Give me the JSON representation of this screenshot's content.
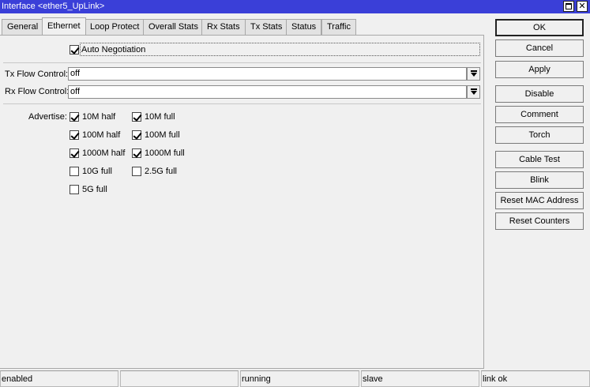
{
  "window": {
    "title": "Interface <ether5_UpLink>",
    "title_color": "#3a3fd8"
  },
  "tabs": [
    {
      "label": "General",
      "active": false
    },
    {
      "label": "Ethernet",
      "active": true
    },
    {
      "label": "Loop Protect",
      "active": false
    },
    {
      "label": "Overall Stats",
      "active": false
    },
    {
      "label": "Rx Stats",
      "active": false
    },
    {
      "label": "Tx Stats",
      "active": false
    },
    {
      "label": "Status",
      "active": false
    },
    {
      "label": "Traffic",
      "active": false
    }
  ],
  "ethernet": {
    "auto_negotiation": {
      "label": "Auto Negotiation",
      "checked": true
    },
    "tx_flow_control": {
      "label": "Tx Flow Control:",
      "value": "off"
    },
    "rx_flow_control": {
      "label": "Rx Flow Control:",
      "value": "off"
    },
    "advertise": {
      "label": "Advertise:",
      "options": [
        {
          "label": "10M half",
          "checked": true
        },
        {
          "label": "10M full",
          "checked": true
        },
        {
          "label": "100M half",
          "checked": true
        },
        {
          "label": "100M full",
          "checked": true
        },
        {
          "label": "1000M half",
          "checked": true
        },
        {
          "label": "1000M full",
          "checked": true
        },
        {
          "label": "10G full",
          "checked": false
        },
        {
          "label": "2.5G full",
          "checked": false
        },
        {
          "label": "5G full",
          "checked": false
        }
      ]
    }
  },
  "buttons": {
    "ok": "OK",
    "cancel": "Cancel",
    "apply": "Apply",
    "disable": "Disable",
    "comment": "Comment",
    "torch": "Torch",
    "cable_test": "Cable Test",
    "blink": "Blink",
    "reset_mac": "Reset MAC Address",
    "reset_counters": "Reset Counters"
  },
  "status": [
    "enabled",
    "",
    "running",
    "slave",
    "link ok"
  ]
}
